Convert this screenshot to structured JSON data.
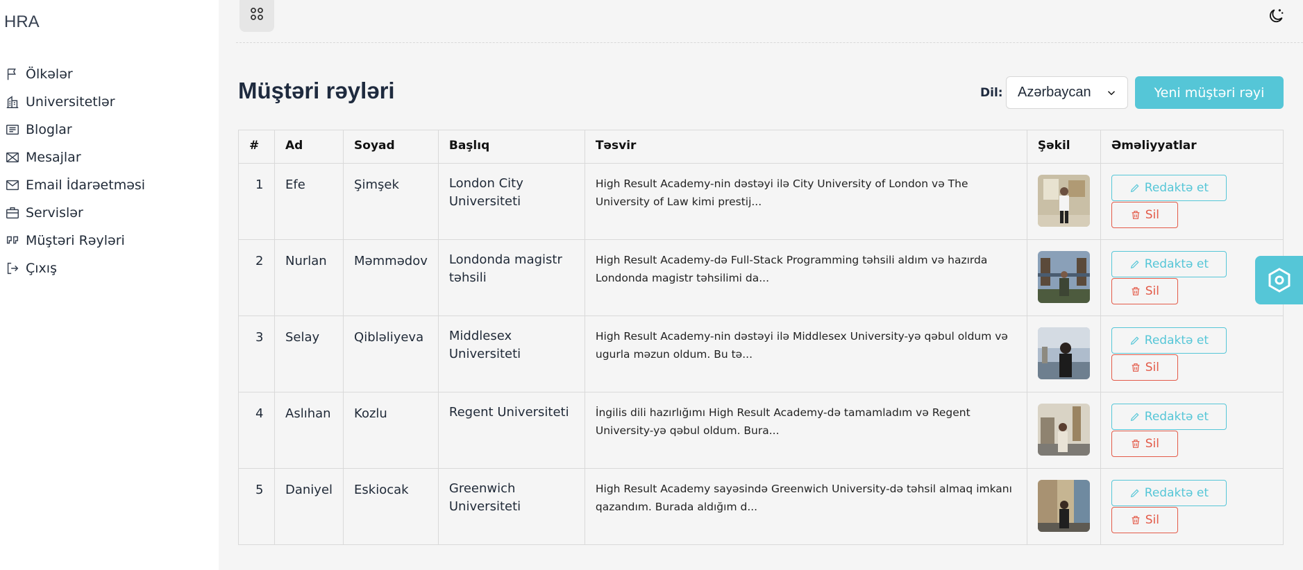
{
  "brand": "HRA",
  "sidebar": {
    "items": [
      {
        "label": "Ölkələr",
        "icon": "flag-icon"
      },
      {
        "label": "Universitetlər",
        "icon": "building-icon"
      },
      {
        "label": "Bloglar",
        "icon": "newspaper-icon"
      },
      {
        "label": "Mesajlar",
        "icon": "envelope-open-icon"
      },
      {
        "label": "Email İdarəetməsi",
        "icon": "envelope-icon"
      },
      {
        "label": "Servislər",
        "icon": "briefcase-icon"
      },
      {
        "label": "Müştəri Rəyləri",
        "icon": "quote-icon"
      },
      {
        "label": "Çıxış",
        "icon": "logout-icon"
      }
    ]
  },
  "header": {
    "title": "Müştəri rəyləri",
    "lang_label": "Dil:",
    "lang_value": "Azərbaycan",
    "new_button": "Yeni müştəri rəyi"
  },
  "table": {
    "columns": [
      "#",
      "Ad",
      "Soyad",
      "Başlıq",
      "Təsvir",
      "Şəkil",
      "Əməliyyatlar"
    ],
    "rows": [
      {
        "num": "1",
        "ad": "Efe",
        "soyad": "Şimşek",
        "basliq": "London City Universiteti",
        "tesvir": "High Result Academy-nin dəstəyi ilə City University of London və The University of Law kimi prestij...",
        "edit": "Redaktə et",
        "delete": "Sil"
      },
      {
        "num": "2",
        "ad": "Nurlan",
        "soyad": "Məmmədov",
        "basliq": "Londonda magistr təhsili",
        "tesvir": "High Result Academy-də Full-Stack Programming təhsili aldım və hazırda Londonda magistr təhsilimi da...",
        "edit": "Redaktə et",
        "delete": "Sil"
      },
      {
        "num": "3",
        "ad": "Selay",
        "soyad": "Qibləliyeva",
        "basliq": "Middlesex Universiteti",
        "tesvir": "High Result Academy-nin dəstəyi ilə Middlesex University-yə qəbul oldum və ugurla məzun oldum. Bu tə...",
        "edit": "Redaktə et",
        "delete": "Sil"
      },
      {
        "num": "4",
        "ad": "Aslıhan",
        "soyad": "Kozlu",
        "basliq": "Regent Universiteti",
        "tesvir": "İngilis dili hazırlığımı High Result Academy-də tamamladım və Regent University-yə qəbul oldum. Bura...",
        "edit": "Redaktə et",
        "delete": "Sil"
      },
      {
        "num": "5",
        "ad": "Daniyel",
        "soyad": "Eskiocak",
        "basliq": "Greenwich Universiteti",
        "tesvir": "High Result Academy sayəsində Greenwich University-də təhsil almaq imkanı qazandım. Burada aldığım d...",
        "edit": "Redaktə et",
        "delete": "Sil"
      }
    ]
  },
  "colors": {
    "accent": "#55c6d7",
    "danger": "#e35a48",
    "title": "#1e2a3e"
  }
}
